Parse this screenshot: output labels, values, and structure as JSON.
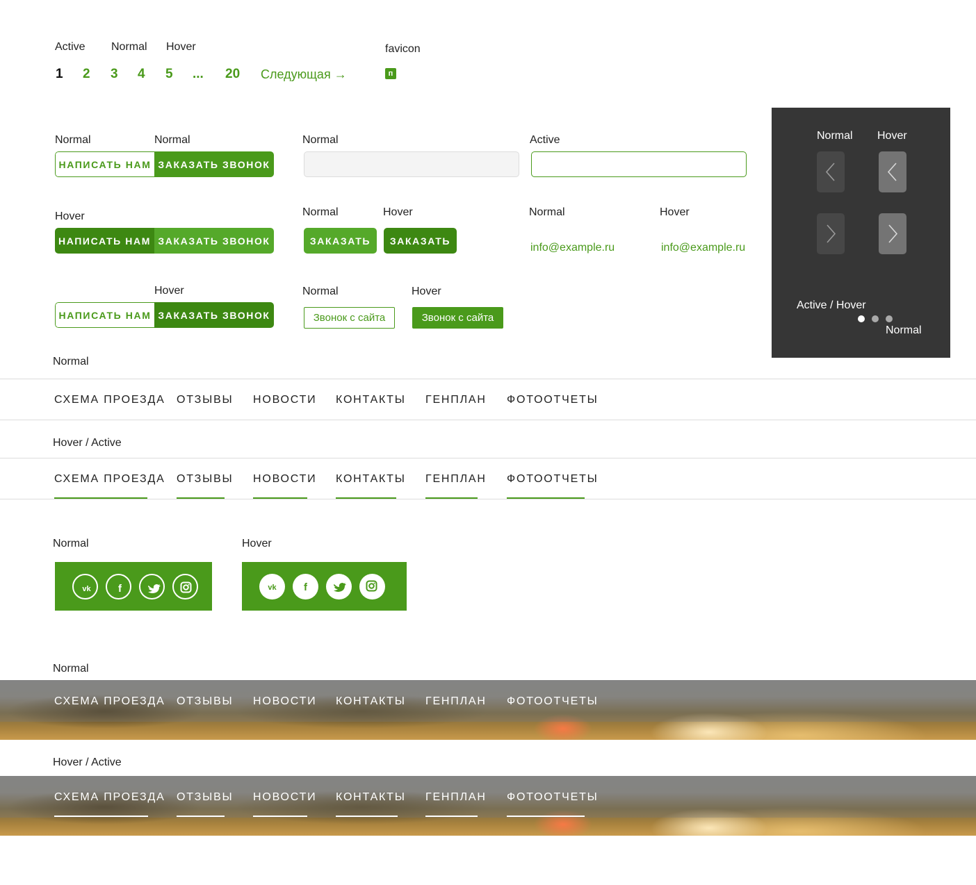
{
  "pagination": {
    "labels": {
      "active": "Active",
      "normal": "Normal",
      "hover": "Hover"
    },
    "pages": [
      "1",
      "2",
      "3",
      "4",
      "5",
      "...",
      "20"
    ],
    "active_page": "1",
    "next": "Следующая →"
  },
  "favicon": {
    "label": "favicon",
    "glyph": "п"
  },
  "buttons": {
    "write": "НАПИСАТЬ НАМ",
    "call": "ЗАКАЗАТЬ ЗВОНОК",
    "order": "ЗАКАЗАТЬ",
    "site_call": "Звонок с сайта"
  },
  "states": {
    "normal": "Normal",
    "hover": "Hover",
    "active": "Active",
    "hover_active": "Hover / Active",
    "active_hover": "Active / Hover"
  },
  "email": "info@example.ru",
  "nav": [
    "СХЕМА ПРОЕЗДА",
    "ОТЗЫВЫ",
    "НОВОСТИ",
    "КОНТАКТЫ",
    "ГЕНПЛАН",
    "ФОТООТЧЕТЫ"
  ],
  "social_icons": [
    "vk-icon",
    "facebook-icon",
    "twitter-icon",
    "instagram-icon"
  ],
  "slider": {
    "dots": 3,
    "active_dot": 1
  },
  "colors": {
    "accent": "#4a9a1b",
    "accent_dark": "#3d8812",
    "panel_bg": "#363636",
    "arrow_normal": "#474747",
    "arrow_hover": "#747474"
  }
}
